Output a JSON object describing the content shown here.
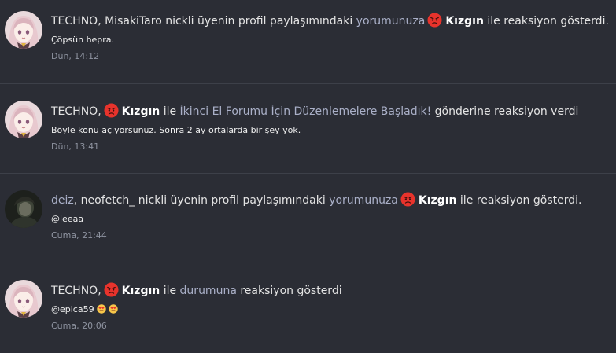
{
  "notifications": [
    {
      "actor": "TECHNO",
      "actor_sep": ",",
      "text_a": " MisakiTaro nickli üyenin profil paylaşımındaki ",
      "link": "yorumunuza",
      "reaction": "Kızgın",
      "text_b": " ile reaksiyon gösterdi.",
      "snippet": "Çöpsün hepra.",
      "time": "Dün, 14:12",
      "avatar_icon": "anime-girl-avatar",
      "reaction_icon": "angry-face-icon"
    },
    {
      "actor": "TECHNO",
      "actor_sep": ",",
      "reaction": "Kızgın",
      "text_mid": " ile ",
      "link": "İkinci El Forumu İçin Düzenlemelere Başladık!",
      "text_b": " gönderine reaksiyon verdi",
      "snippet": "Böyle konu açıyorsunuz. Sonra 2 ay ortalarda bir şey yok.",
      "time": "Dün, 13:41",
      "avatar_icon": "anime-girl-avatar",
      "reaction_icon": "angry-face-icon"
    },
    {
      "actor": "deiz",
      "actor_sep": ",",
      "actor2": " neofetch_",
      "text_a": " nickli üyenin profil paylaşımındaki ",
      "link": "yorumunuza",
      "reaction": "Kızgın",
      "text_b": " ile reaksiyon gösterdi.",
      "snippet": "@leeaa",
      "time": "Cuma, 21:44",
      "avatar_icon": "dark-photo-avatar",
      "reaction_icon": "angry-face-icon"
    },
    {
      "actor": "TECHNO",
      "actor_sep": ",",
      "reaction": "Kızgın",
      "text_mid": " ile ",
      "link": "durumuna",
      "text_b": " reaksiyon gösterdi",
      "snippet": "@epica59",
      "time": "Cuma, 20:06",
      "avatar_icon": "anime-girl-avatar",
      "reaction_icon": "angry-face-icon",
      "snippet_icon": "heart-eyes-emoji-icon"
    }
  ],
  "colors": {
    "background": "#2b2d35",
    "divider": "#3d4049",
    "link": "#aab0c8",
    "time": "#8e93a0",
    "angry_face": "#e8332c"
  }
}
